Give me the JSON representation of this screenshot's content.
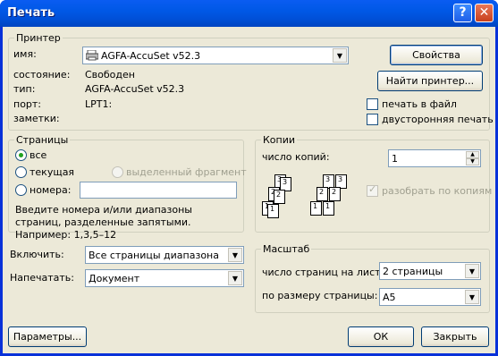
{
  "window": {
    "title": "Печать",
    "help_glyph": "?",
    "close_glyph": "✕"
  },
  "printer": {
    "legend": "Принтер",
    "name_label": "имя:",
    "name_value": "AGFA-AccuSet v52.3",
    "status_label": "состояние:",
    "status_value": "Свободен",
    "type_label": "тип:",
    "type_value": "AGFA-AccuSet v52.3",
    "port_label": "порт:",
    "port_value": "LPT1:",
    "notes_label": "заметки:",
    "properties_button": "Свойства",
    "find_printer_button": "Найти принтер...",
    "print_to_file": "печать в файл",
    "duplex": "двусторонняя печать"
  },
  "pages": {
    "legend": "Страницы",
    "all": "все",
    "current": "текущая",
    "selection": "выделенный фрагмент",
    "numbers": "номера:",
    "numbers_value": "",
    "hint": "Введите номера и/или диапазоны страниц, разделенные запятыми. Например: 1,3,5–12"
  },
  "copies": {
    "legend": "Копии",
    "count_label": "число копий:",
    "count_value": "1",
    "collate": "разобрать по копиям"
  },
  "include": {
    "label": "Включить:",
    "value": "Все страницы диапазона"
  },
  "print_what": {
    "label": "Напечатать:",
    "value": "Документ"
  },
  "scale": {
    "legend": "Масштаб",
    "pages_per_sheet_label": "число страниц на листе:",
    "pages_per_sheet_value": "2 страницы",
    "fit_to_label": "по размеру страницы:",
    "fit_to_value": "A5"
  },
  "footer": {
    "options_button": "Параметры...",
    "ok_button": "ОК",
    "close_button": "Закрыть"
  }
}
